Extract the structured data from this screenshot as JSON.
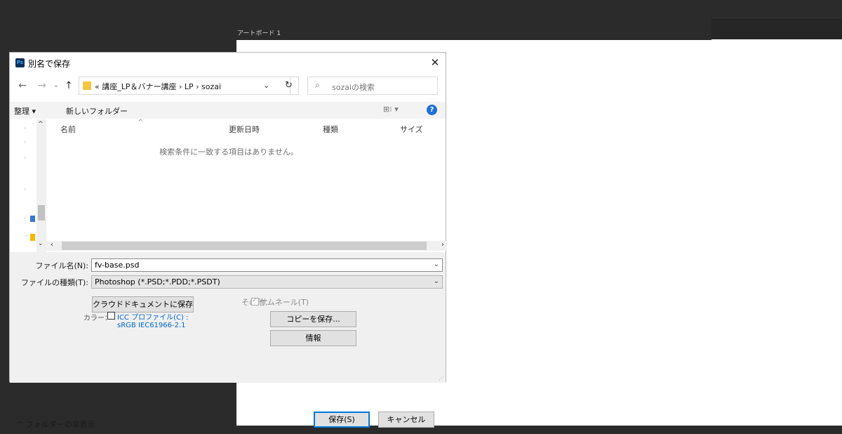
{
  "workspace": {
    "artboard_label": "アートボード 1"
  },
  "dialog": {
    "app_icon": "Ps",
    "title": "別名で保存",
    "close_glyph": "✕",
    "nav": {
      "back": "←",
      "forward": "→",
      "recent": "⌄",
      "up": "↑",
      "breadcrumb": "« 講座_LP＆バナー講座 › LP › sozai",
      "dropdown": "⌄",
      "refresh": "↻",
      "search_placeholder": "sozaiの検索"
    },
    "toolbar": {
      "organize": "整理 ▾",
      "new_folder": "新しいフォルダー",
      "view": "⊞⁝ ▾",
      "help": "?"
    },
    "columns": {
      "name": "名前",
      "date": "更新日時",
      "type": "種類",
      "size": "サイズ"
    },
    "empty_message": "検索条件に一致する項目はありません。",
    "filename_label": "ファイル名(N):",
    "filename_value": "fv-base.psd",
    "filetype_label": "ファイルの種類(T):",
    "filetype_value": "Photoshop (*.PSD;*.PDD;*.PSDT)",
    "cloud_button": "クラウドドキュメントに保存",
    "color_label": "カラー：",
    "icc_profile_label": "ICC プロファイル(C) :",
    "icc_profile_value": "sRGB IEC61966-2.1",
    "other_label": "その他：",
    "thumbnail_label": "サムネール(T)",
    "save_copy_button": "コピーを保存...",
    "info_button": "情報",
    "hide_folders": "^  フォルダーの非表示",
    "save_button": "保存(S)",
    "cancel_button": "キャンセル"
  }
}
